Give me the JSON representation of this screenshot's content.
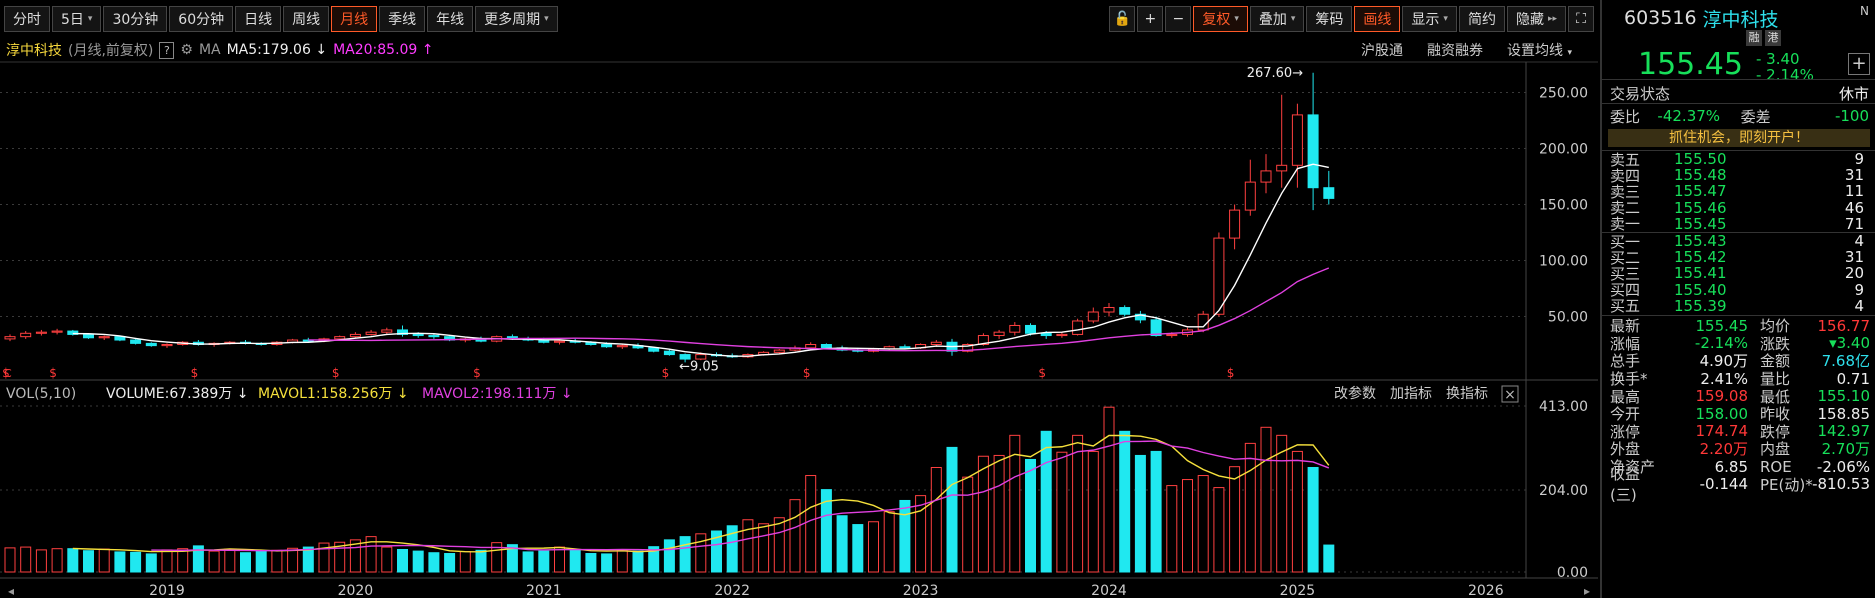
{
  "toolbar": {
    "periods": [
      "分时",
      "5日",
      "30分钟",
      "60分钟",
      "日线",
      "周线",
      "月线",
      "季线",
      "年线",
      "更多周期"
    ],
    "active": "月线",
    "icons": [
      "lock-icon",
      "zoom-in-icon",
      "zoom-out-icon"
    ],
    "tools": [
      "复权",
      "叠加",
      "筹码",
      "画线",
      "显示",
      "简约",
      "隐藏"
    ],
    "expand": "expand-icon"
  },
  "title": {
    "name": "淳中科技",
    "mode": "(月线,前复权)",
    "q": "?",
    "ma_label": "MA",
    "ma5": "MA5:179.06",
    "ma5_arrow": "↓",
    "ma20": "MA20:85.09",
    "ma20_arrow": "↑",
    "links": [
      "沪股通",
      "融资融券",
      "设置均线"
    ]
  },
  "vol_title": {
    "label": "VOL(5,10)",
    "volume": "VOLUME:67.389万",
    "mavol1": "MAVOL1:158.256万",
    "mavol2": "MAVOL2:198.111万",
    "links": [
      "改参数",
      "加指标",
      "换指标"
    ]
  },
  "chart_data": {
    "type": "candlestick",
    "period": "monthly",
    "ylabels": [
      "250.00",
      "200.00",
      "150.00",
      "100.00",
      "50.00"
    ],
    "high_label": "267.60",
    "low_label": "9.05",
    "vol_labels": [
      "413.00",
      "204.00",
      "0.00"
    ],
    "years": [
      "2019",
      "2020",
      "2021",
      "2022",
      "2023",
      "2024",
      "2025",
      "2026"
    ],
    "candles": [
      [
        30,
        34,
        28,
        32
      ],
      [
        32,
        37,
        30,
        35
      ],
      [
        35,
        38,
        33,
        36
      ],
      [
        36,
        39,
        34,
        37
      ],
      [
        37,
        38,
        33,
        34
      ],
      [
        34,
        35,
        30,
        31
      ],
      [
        31,
        33,
        29,
        32
      ],
      [
        32,
        33,
        28,
        29
      ],
      [
        29,
        30,
        25,
        26
      ],
      [
        26,
        27,
        23,
        24
      ],
      [
        24,
        26,
        22,
        25
      ],
      [
        25,
        28,
        24,
        27
      ],
      [
        27,
        29,
        24,
        25
      ],
      [
        25,
        27,
        23,
        26
      ],
      [
        26,
        28,
        25,
        27
      ],
      [
        27,
        29,
        25,
        26
      ],
      [
        26,
        27,
        24,
        25
      ],
      [
        25,
        28,
        24,
        27
      ],
      [
        27,
        30,
        26,
        29
      ],
      [
        29,
        31,
        27,
        28
      ],
      [
        28,
        31,
        27,
        30
      ],
      [
        30,
        33,
        29,
        32
      ],
      [
        32,
        36,
        31,
        34
      ],
      [
        34,
        38,
        33,
        36
      ],
      [
        36,
        40,
        34,
        38
      ],
      [
        38,
        42,
        32,
        34
      ],
      [
        34,
        36,
        31,
        33
      ],
      [
        33,
        35,
        30,
        32
      ],
      [
        32,
        33,
        28,
        29
      ],
      [
        29,
        31,
        27,
        30
      ],
      [
        30,
        32,
        27,
        28
      ],
      [
        28,
        33,
        27,
        32
      ],
      [
        32,
        34,
        29,
        30
      ],
      [
        30,
        32,
        28,
        29
      ],
      [
        29,
        31,
        26,
        27
      ],
      [
        27,
        29,
        25,
        28
      ],
      [
        28,
        30,
        26,
        27
      ],
      [
        27,
        28,
        24,
        25
      ],
      [
        25,
        27,
        22,
        23
      ],
      [
        23,
        25,
        21,
        24
      ],
      [
        24,
        26,
        21,
        22
      ],
      [
        22,
        23,
        18,
        19
      ],
      [
        19,
        21,
        15,
        16
      ],
      [
        16,
        17,
        9.05,
        12
      ],
      [
        12,
        18,
        11,
        16
      ],
      [
        16,
        18,
        14,
        15
      ],
      [
        15,
        17,
        13,
        14
      ],
      [
        14,
        17,
        13,
        16
      ],
      [
        16,
        19,
        15,
        18
      ],
      [
        18,
        21,
        17,
        20
      ],
      [
        20,
        24,
        19,
        22
      ],
      [
        22,
        27,
        20,
        25
      ],
      [
        25,
        26,
        21,
        22
      ],
      [
        22,
        24,
        19,
        20
      ],
      [
        20,
        22,
        18,
        19
      ],
      [
        19,
        22,
        18,
        21
      ],
      [
        21,
        24,
        20,
        23
      ],
      [
        23,
        25,
        21,
        22
      ],
      [
        22,
        26,
        21,
        25
      ],
      [
        25,
        29,
        23,
        27
      ],
      [
        27,
        30,
        15,
        19
      ],
      [
        19,
        26,
        18,
        25
      ],
      [
        25,
        35,
        24,
        33
      ],
      [
        33,
        38,
        30,
        36
      ],
      [
        36,
        45,
        33,
        42
      ],
      [
        42,
        44,
        33,
        35
      ],
      [
        35,
        37,
        30,
        33
      ],
      [
        33,
        36,
        31,
        34
      ],
      [
        34,
        48,
        33,
        46
      ],
      [
        46,
        58,
        44,
        54
      ],
      [
        54,
        62,
        50,
        58
      ],
      [
        58,
        60,
        50,
        52
      ],
      [
        52,
        55,
        44,
        47
      ],
      [
        47,
        50,
        32,
        33
      ],
      [
        33,
        36,
        31,
        34
      ],
      [
        34,
        40,
        32,
        38
      ],
      [
        38,
        55,
        36,
        52
      ],
      [
        52,
        125,
        50,
        120
      ],
      [
        120,
        150,
        110,
        145
      ],
      [
        145,
        190,
        140,
        170
      ],
      [
        170,
        195,
        160,
        180
      ],
      [
        180,
        248,
        165,
        185
      ],
      [
        185,
        240,
        165,
        230
      ],
      [
        230,
        267.6,
        145,
        165
      ],
      [
        165,
        180,
        150,
        155.45
      ]
    ],
    "volumes": [
      60,
      62,
      55,
      58,
      58,
      53,
      57,
      50,
      49,
      45,
      55,
      58,
      65,
      52,
      57,
      48,
      51,
      54,
      59,
      62,
      72,
      74,
      80,
      88,
      62,
      56,
      52,
      48,
      46,
      51,
      54,
      73,
      68,
      50,
      52,
      62,
      55,
      46,
      45,
      55,
      52,
      63,
      80,
      88,
      95,
      102,
      115,
      130,
      120,
      135,
      180,
      240,
      205,
      140,
      118,
      125,
      150,
      178,
      190,
      260,
      310,
      236,
      288,
      290,
      340,
      280,
      350,
      298,
      340,
      300,
      410,
      350,
      290,
      300,
      215,
      230,
      240,
      210,
      262,
      320,
      360,
      340,
      300,
      260,
      67
    ]
  },
  "panel": {
    "code": "603516",
    "name": "淳中科技",
    "tags": [
      "融",
      "港"
    ],
    "corner": "N",
    "price": "155.45",
    "chg": "- 3.40",
    "pct": "- 2.14%",
    "trade_k": "交易状态",
    "trade_v": "休市",
    "wb_k": "委比",
    "wb_v": "-42.37%",
    "wc_k": "委差",
    "wc_v": "-100",
    "promo": "抓住机会，即刻开户！",
    "asks": [
      {
        "l": "卖五",
        "p": "155.50",
        "v": "9"
      },
      {
        "l": "卖四",
        "p": "155.48",
        "v": "31"
      },
      {
        "l": "卖三",
        "p": "155.47",
        "v": "11"
      },
      {
        "l": "卖二",
        "p": "155.46",
        "v": "46"
      },
      {
        "l": "卖一",
        "p": "155.45",
        "v": "71"
      }
    ],
    "bids": [
      {
        "l": "买一",
        "p": "155.43",
        "v": "4"
      },
      {
        "l": "买二",
        "p": "155.42",
        "v": "31"
      },
      {
        "l": "买三",
        "p": "155.41",
        "v": "20"
      },
      {
        "l": "买四",
        "p": "155.40",
        "v": "9"
      },
      {
        "l": "买五",
        "p": "155.39",
        "v": "4"
      }
    ],
    "stats": [
      {
        "k1": "最新",
        "v1": "155.45",
        "c1": "g",
        "k2": "均价",
        "v2": "156.77",
        "c2": "r"
      },
      {
        "k1": "涨幅",
        "v1": "-2.14%",
        "c1": "g",
        "k2": "涨跌",
        "v2": "▾3.40",
        "c2": "g"
      },
      {
        "k1": "总手",
        "v1": "4.90万",
        "c1": "w",
        "k2": "金额",
        "v2": "7.68亿",
        "c2": "c"
      },
      {
        "k1": "换手*",
        "v1": "2.41%",
        "c1": "w",
        "k2": "量比",
        "v2": "0.71",
        "c2": "w"
      },
      {
        "k1": "最高",
        "v1": "159.08",
        "c1": "r",
        "k2": "最低",
        "v2": "155.10",
        "c2": "g"
      },
      {
        "k1": "今开",
        "v1": "158.00",
        "c1": "g",
        "k2": "昨收",
        "v2": "158.85",
        "c2": "w"
      },
      {
        "k1": "涨停",
        "v1": "174.74",
        "c1": "r",
        "k2": "跌停",
        "v2": "142.97",
        "c2": "g"
      },
      {
        "k1": "外盘",
        "v1": "2.20万",
        "c1": "r",
        "k2": "内盘",
        "v2": "2.70万",
        "c2": "g"
      },
      {
        "k1": "净资产",
        "v1": "6.85",
        "c1": "w",
        "k2": "ROE",
        "v2": "-2.06%",
        "c2": "w"
      },
      {
        "k1": "收益(三)",
        "v1": "-0.144",
        "c1": "w",
        "k2": "PE(动)*",
        "v2": "-810.53",
        "c2": "w"
      }
    ]
  },
  "colors": {
    "up": "#ff4040",
    "down": "#20e8f0",
    "ma5": "#ffffff",
    "ma20": "#e040e0",
    "mavol1": "#f5e03c",
    "mavol2": "#e040e0"
  }
}
